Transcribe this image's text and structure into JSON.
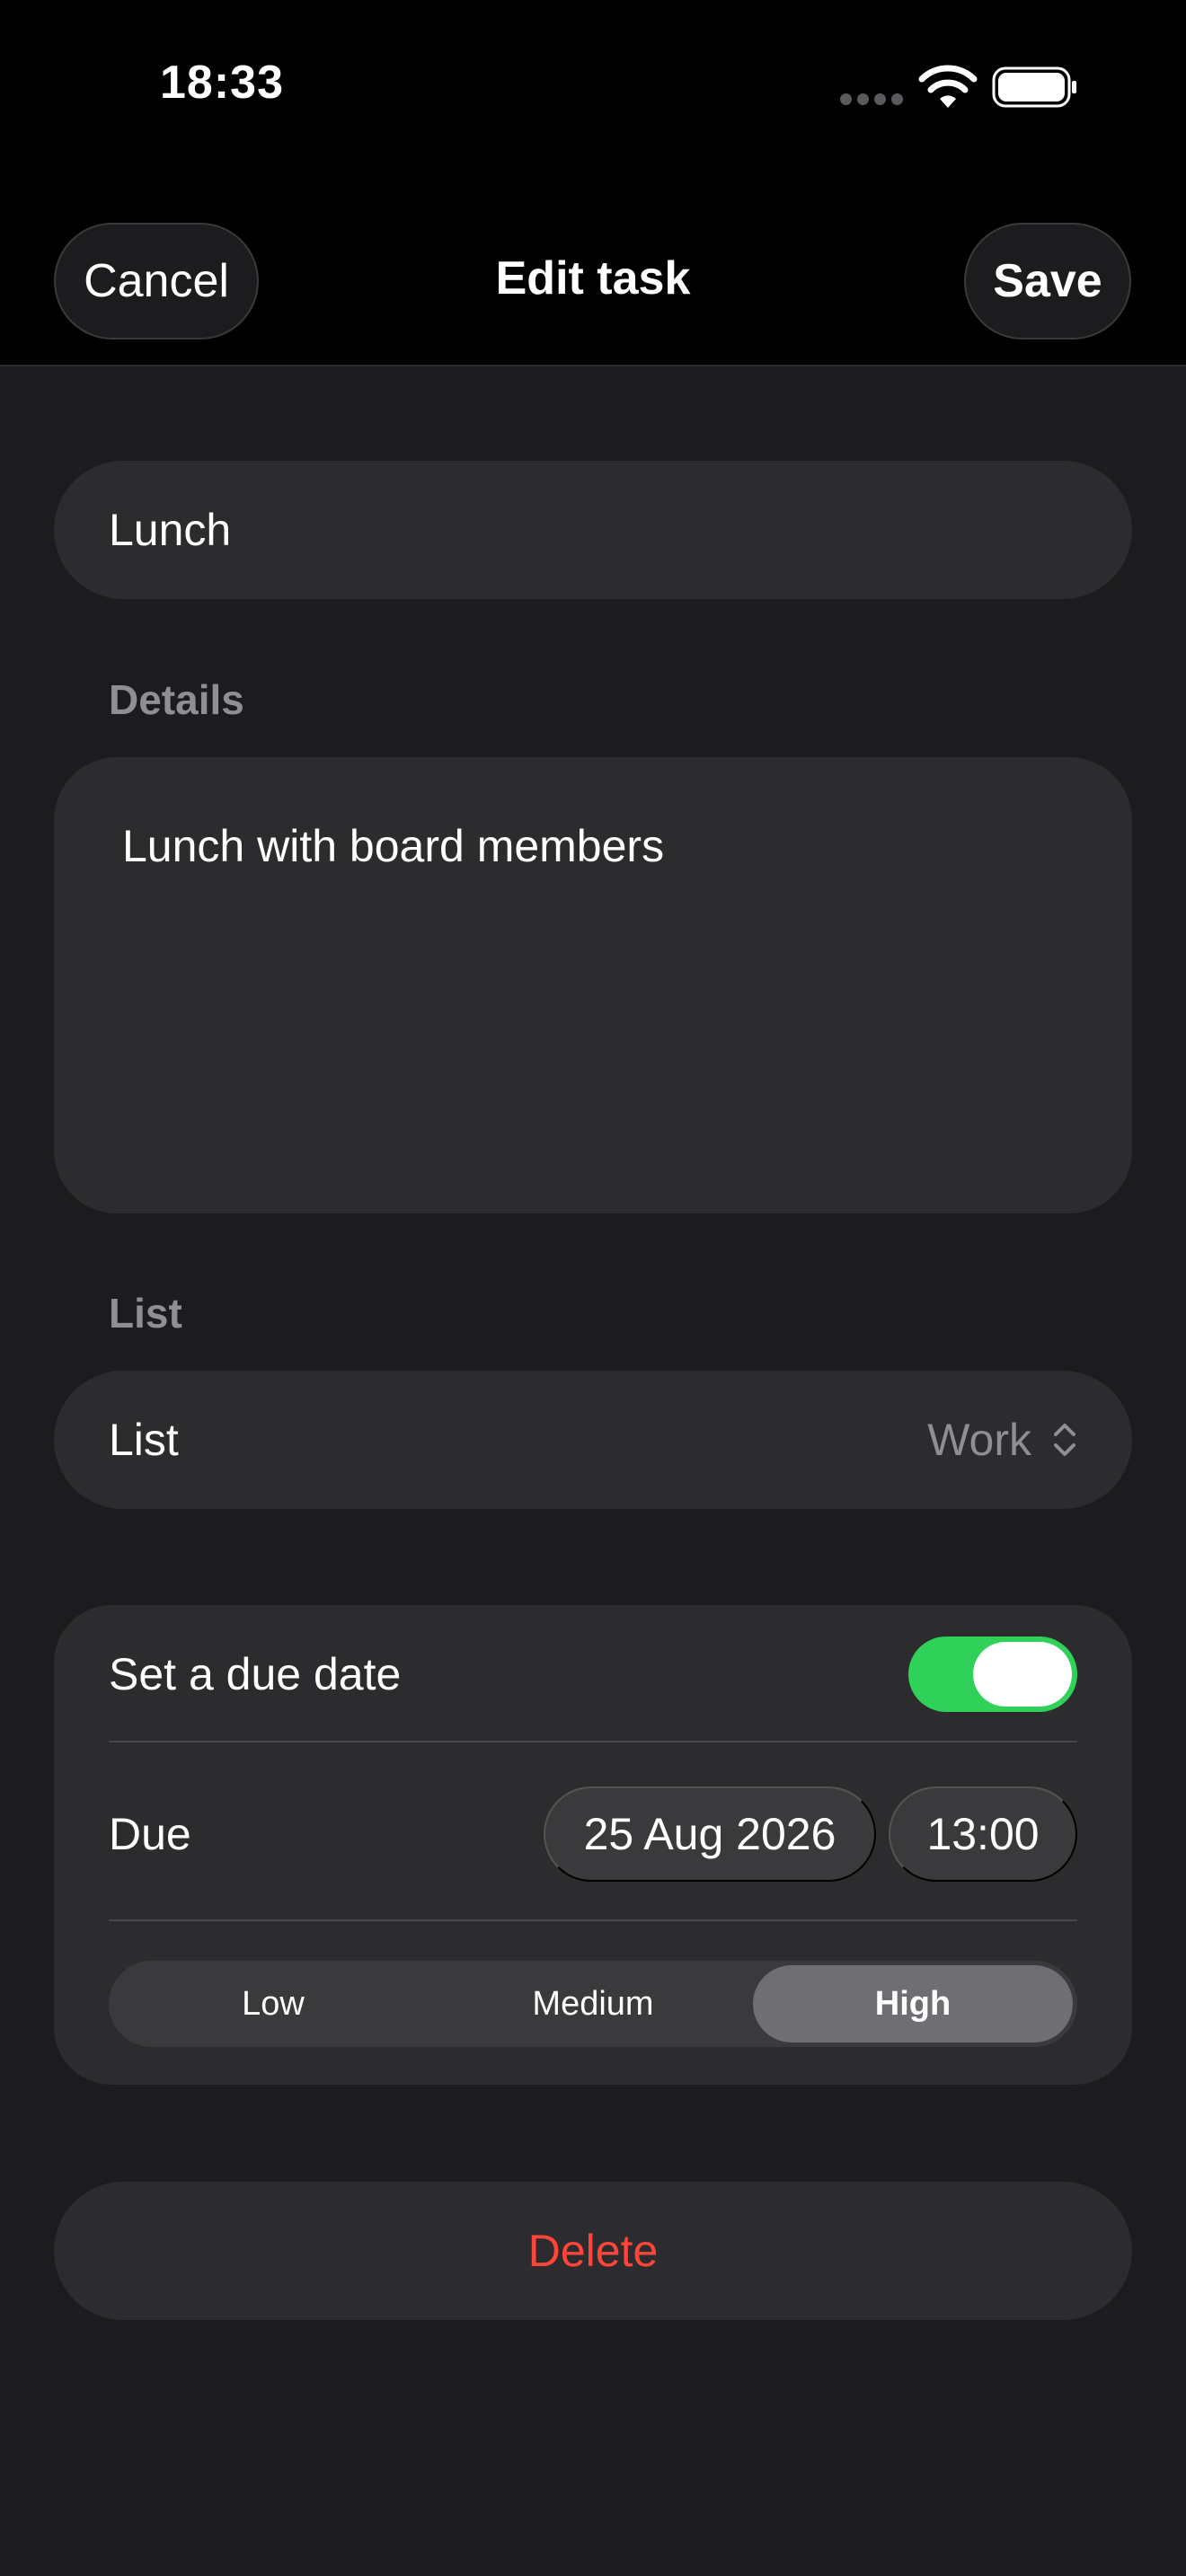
{
  "status_bar": {
    "time": "18:33"
  },
  "nav": {
    "cancel_label": "Cancel",
    "title": "Edit task",
    "save_label": "Save"
  },
  "task": {
    "title": "Lunch",
    "details_label": "Details",
    "details": "Lunch with board members"
  },
  "list_section": {
    "header": "List",
    "row_label": "List",
    "value": "Work"
  },
  "due": {
    "toggle_label": "Set a due date",
    "toggle_on": true,
    "due_label": "Due",
    "date": "25 Aug 2026",
    "time": "13:00"
  },
  "priority": {
    "options": [
      "Low",
      "Medium",
      "High"
    ],
    "selected": "High"
  },
  "delete_label": "Delete",
  "icons": [
    "wifi-icon",
    "battery-icon",
    "chevron-up-down-icon"
  ],
  "colors": {
    "accent_green": "#30d158",
    "destructive_red": "#ff453a",
    "background": "#1c1c1e",
    "field": "#2c2c2e"
  }
}
